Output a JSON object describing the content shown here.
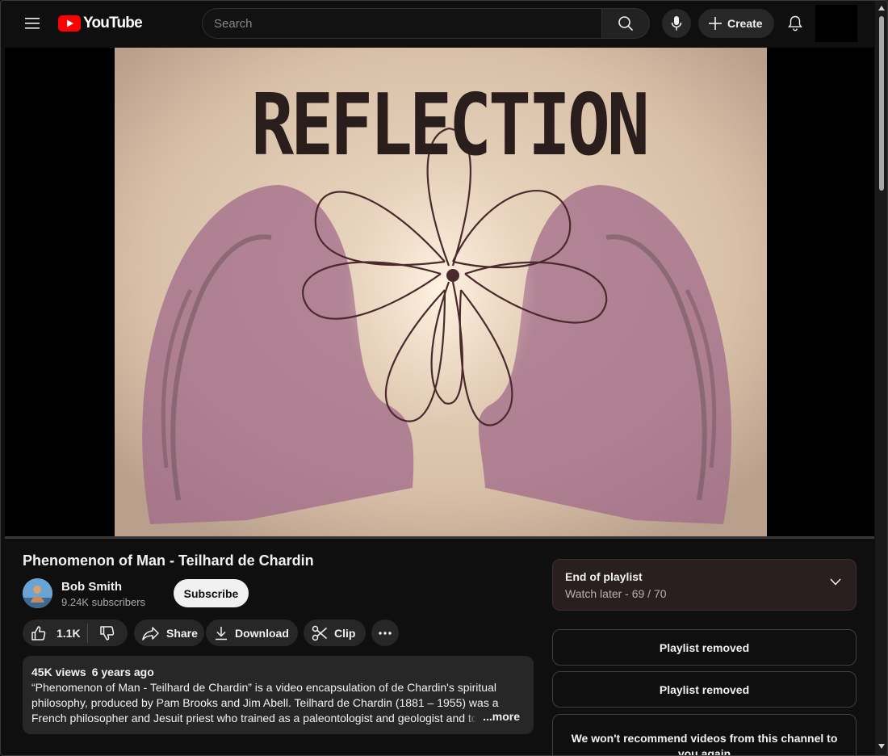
{
  "header": {
    "logo_text": "YouTube",
    "search_placeholder": "Search",
    "create_label": "Create"
  },
  "video": {
    "title": "Phenomenon of Man - Teilhard de Chardin",
    "frame_caption": "REFLECTION",
    "channel": {
      "name": "Bob Smith",
      "subscribers": "9.24K subscribers",
      "subscribe_label": "Subscribe"
    },
    "actions": {
      "likes": "1.1K",
      "share_label": "Share",
      "download_label": "Download",
      "clip_label": "Clip"
    },
    "description": {
      "views": "45K views",
      "age": "6 years ago",
      "text": "“Phenomenon of Man - Teilhard de Chardin” is a video encapsulation of de Chardin's spiritual philosophy, produced by Pam Brooks and Jim Abell.   Teilhard de Chardin (1881 – 1955) was a French philosopher and Jesuit priest who trained as a paleontologist and geologist and to",
      "more_label": "...more"
    }
  },
  "playlist": {
    "title": "End of playlist",
    "subtitle": "Watch later - 69 / 70"
  },
  "sidebar_cards": [
    {
      "label": "Playlist removed"
    },
    {
      "label": "Playlist removed"
    },
    {
      "label": "We won't recommend videos from this channel to you again"
    }
  ],
  "colors": {
    "background": "#0f0f0f",
    "brand_red": "#ff0000",
    "pill_bg": "#272727",
    "playlist_bg": "#2a1f1f"
  }
}
